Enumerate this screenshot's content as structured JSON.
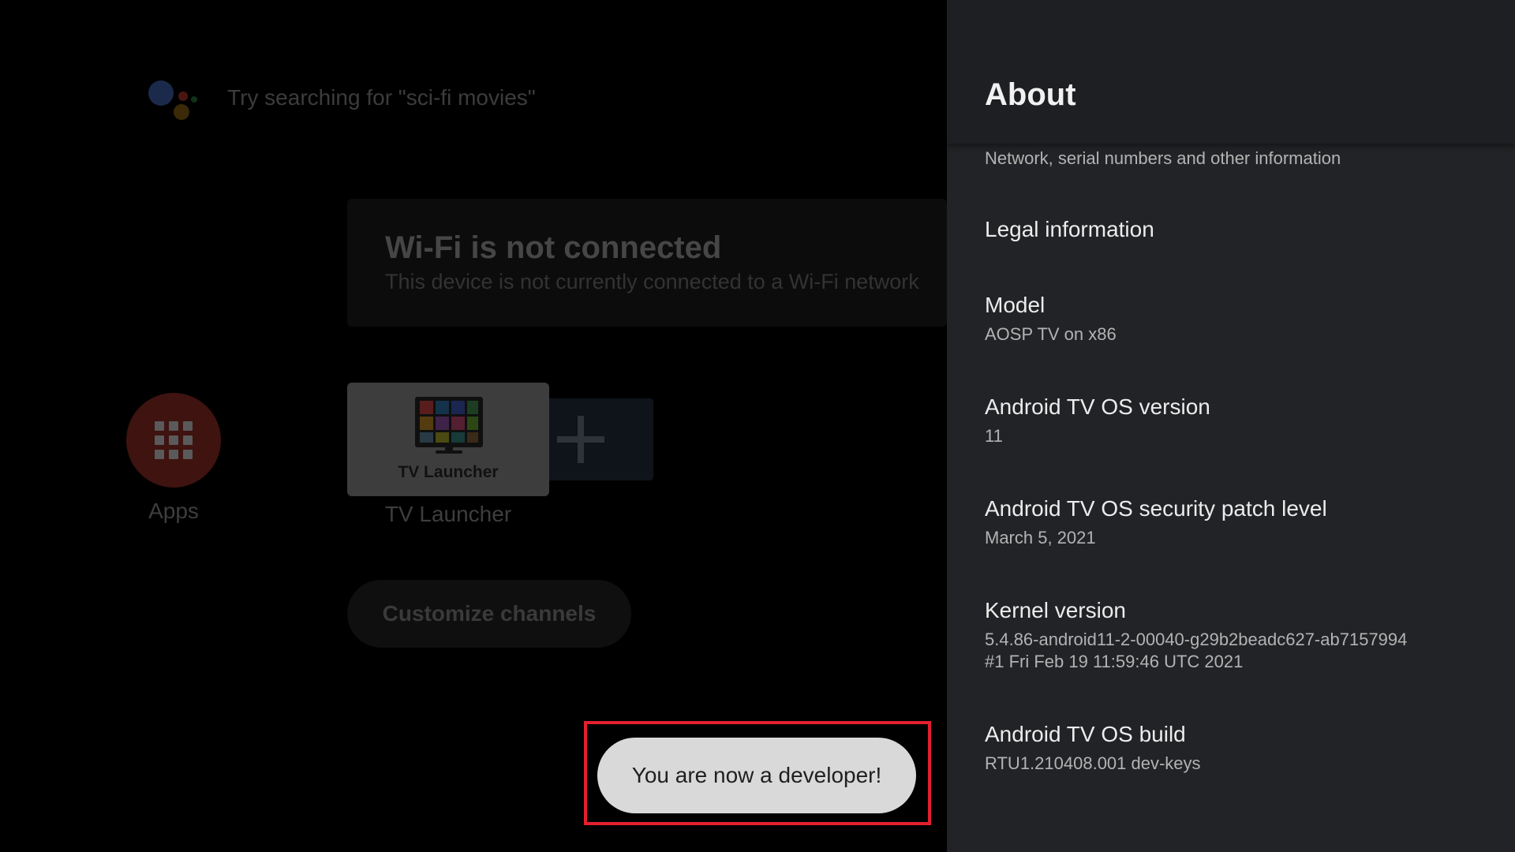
{
  "launcher": {
    "search_hint": "Try searching for \"sci-fi movies\"",
    "wifi_card": {
      "title": "Wi-Fi is not connected",
      "subtitle": "This device is not currently connected to a Wi-Fi network"
    },
    "apps_label": "Apps",
    "tv_tile_text": "TV Launcher",
    "tv_label": "TV Launcher",
    "customize_channels": "Customize channels"
  },
  "toast": {
    "message": "You are now a developer!"
  },
  "about_panel": {
    "title": "About",
    "partial_summary": "Network, serial numbers and other information",
    "items": [
      {
        "title": "Legal information",
        "summary": ""
      },
      {
        "title": "Model",
        "summary": "AOSP TV on x86"
      },
      {
        "title": "Android TV OS version",
        "summary": "11"
      },
      {
        "title": "Android TV OS security patch level",
        "summary": "March 5, 2021"
      },
      {
        "title": "Kernel version",
        "summary": "5.4.86-android11-2-00040-g29b2beadc627-ab7157994",
        "summary2": "#1 Fri Feb 19 11:59:46 UTC 2021"
      },
      {
        "title": "Android TV OS build",
        "summary": "RTU1.210408.001 dev-keys"
      }
    ]
  },
  "colors": {
    "panel_bg": "#222326",
    "toast_bg": "#d9d9d9",
    "highlight_border": "#e4202e",
    "apps_circle": "#3e1310"
  },
  "icons": [
    "google-assistant-icon",
    "apps-grid-icon",
    "tv-launcher-icon",
    "add-plus-icon"
  ]
}
